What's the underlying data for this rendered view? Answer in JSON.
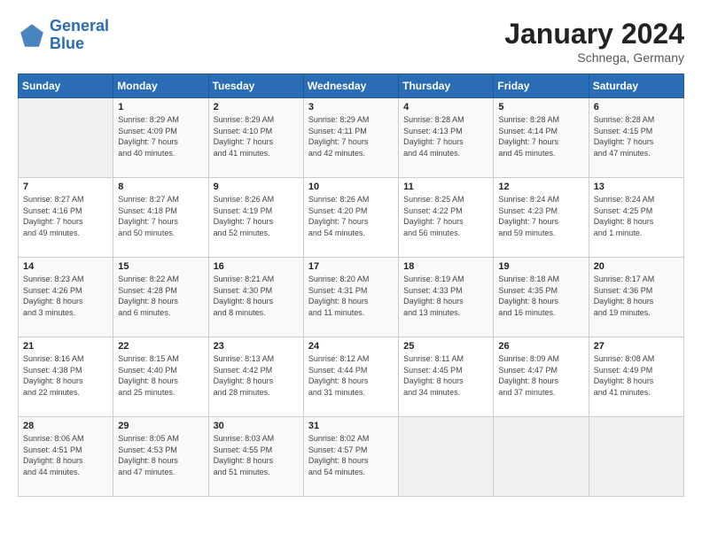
{
  "header": {
    "logo_line1": "General",
    "logo_line2": "Blue",
    "month": "January 2024",
    "location": "Schnega, Germany"
  },
  "days_of_week": [
    "Sunday",
    "Monday",
    "Tuesday",
    "Wednesday",
    "Thursday",
    "Friday",
    "Saturday"
  ],
  "weeks": [
    [
      {
        "day": "",
        "info": ""
      },
      {
        "day": "1",
        "info": "Sunrise: 8:29 AM\nSunset: 4:09 PM\nDaylight: 7 hours\nand 40 minutes."
      },
      {
        "day": "2",
        "info": "Sunrise: 8:29 AM\nSunset: 4:10 PM\nDaylight: 7 hours\nand 41 minutes."
      },
      {
        "day": "3",
        "info": "Sunrise: 8:29 AM\nSunset: 4:11 PM\nDaylight: 7 hours\nand 42 minutes."
      },
      {
        "day": "4",
        "info": "Sunrise: 8:28 AM\nSunset: 4:13 PM\nDaylight: 7 hours\nand 44 minutes."
      },
      {
        "day": "5",
        "info": "Sunrise: 8:28 AM\nSunset: 4:14 PM\nDaylight: 7 hours\nand 45 minutes."
      },
      {
        "day": "6",
        "info": "Sunrise: 8:28 AM\nSunset: 4:15 PM\nDaylight: 7 hours\nand 47 minutes."
      }
    ],
    [
      {
        "day": "7",
        "info": "Sunrise: 8:27 AM\nSunset: 4:16 PM\nDaylight: 7 hours\nand 49 minutes."
      },
      {
        "day": "8",
        "info": "Sunrise: 8:27 AM\nSunset: 4:18 PM\nDaylight: 7 hours\nand 50 minutes."
      },
      {
        "day": "9",
        "info": "Sunrise: 8:26 AM\nSunset: 4:19 PM\nDaylight: 7 hours\nand 52 minutes."
      },
      {
        "day": "10",
        "info": "Sunrise: 8:26 AM\nSunset: 4:20 PM\nDaylight: 7 hours\nand 54 minutes."
      },
      {
        "day": "11",
        "info": "Sunrise: 8:25 AM\nSunset: 4:22 PM\nDaylight: 7 hours\nand 56 minutes."
      },
      {
        "day": "12",
        "info": "Sunrise: 8:24 AM\nSunset: 4:23 PM\nDaylight: 7 hours\nand 59 minutes."
      },
      {
        "day": "13",
        "info": "Sunrise: 8:24 AM\nSunset: 4:25 PM\nDaylight: 8 hours\nand 1 minute."
      }
    ],
    [
      {
        "day": "14",
        "info": "Sunrise: 8:23 AM\nSunset: 4:26 PM\nDaylight: 8 hours\nand 3 minutes."
      },
      {
        "day": "15",
        "info": "Sunrise: 8:22 AM\nSunset: 4:28 PM\nDaylight: 8 hours\nand 6 minutes."
      },
      {
        "day": "16",
        "info": "Sunrise: 8:21 AM\nSunset: 4:30 PM\nDaylight: 8 hours\nand 8 minutes."
      },
      {
        "day": "17",
        "info": "Sunrise: 8:20 AM\nSunset: 4:31 PM\nDaylight: 8 hours\nand 11 minutes."
      },
      {
        "day": "18",
        "info": "Sunrise: 8:19 AM\nSunset: 4:33 PM\nDaylight: 8 hours\nand 13 minutes."
      },
      {
        "day": "19",
        "info": "Sunrise: 8:18 AM\nSunset: 4:35 PM\nDaylight: 8 hours\nand 16 minutes."
      },
      {
        "day": "20",
        "info": "Sunrise: 8:17 AM\nSunset: 4:36 PM\nDaylight: 8 hours\nand 19 minutes."
      }
    ],
    [
      {
        "day": "21",
        "info": "Sunrise: 8:16 AM\nSunset: 4:38 PM\nDaylight: 8 hours\nand 22 minutes."
      },
      {
        "day": "22",
        "info": "Sunrise: 8:15 AM\nSunset: 4:40 PM\nDaylight: 8 hours\nand 25 minutes."
      },
      {
        "day": "23",
        "info": "Sunrise: 8:13 AM\nSunset: 4:42 PM\nDaylight: 8 hours\nand 28 minutes."
      },
      {
        "day": "24",
        "info": "Sunrise: 8:12 AM\nSunset: 4:44 PM\nDaylight: 8 hours\nand 31 minutes."
      },
      {
        "day": "25",
        "info": "Sunrise: 8:11 AM\nSunset: 4:45 PM\nDaylight: 8 hours\nand 34 minutes."
      },
      {
        "day": "26",
        "info": "Sunrise: 8:09 AM\nSunset: 4:47 PM\nDaylight: 8 hours\nand 37 minutes."
      },
      {
        "day": "27",
        "info": "Sunrise: 8:08 AM\nSunset: 4:49 PM\nDaylight: 8 hours\nand 41 minutes."
      }
    ],
    [
      {
        "day": "28",
        "info": "Sunrise: 8:06 AM\nSunset: 4:51 PM\nDaylight: 8 hours\nand 44 minutes."
      },
      {
        "day": "29",
        "info": "Sunrise: 8:05 AM\nSunset: 4:53 PM\nDaylight: 8 hours\nand 47 minutes."
      },
      {
        "day": "30",
        "info": "Sunrise: 8:03 AM\nSunset: 4:55 PM\nDaylight: 8 hours\nand 51 minutes."
      },
      {
        "day": "31",
        "info": "Sunrise: 8:02 AM\nSunset: 4:57 PM\nDaylight: 8 hours\nand 54 minutes."
      },
      {
        "day": "",
        "info": ""
      },
      {
        "day": "",
        "info": ""
      },
      {
        "day": "",
        "info": ""
      }
    ]
  ]
}
